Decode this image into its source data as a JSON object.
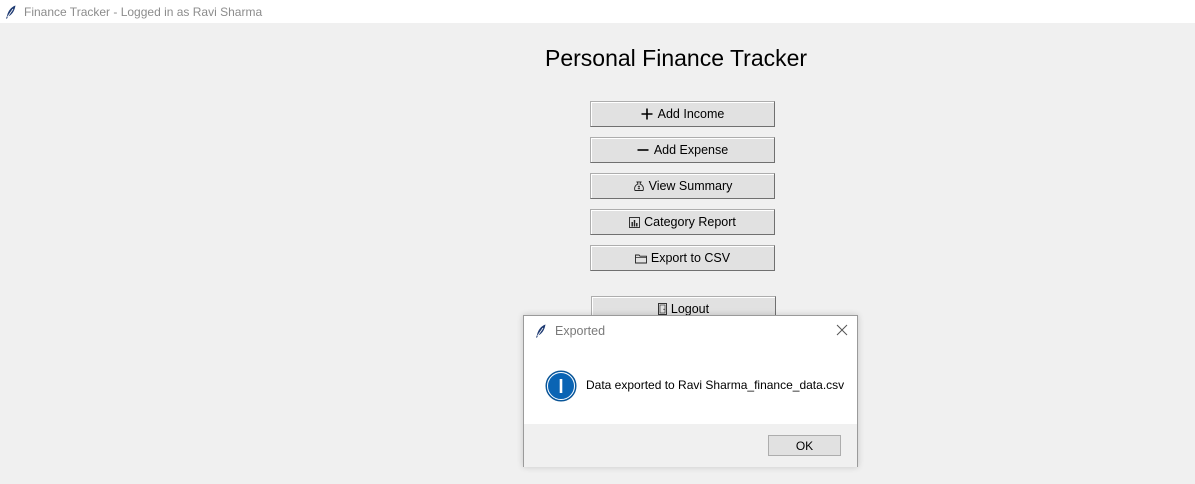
{
  "window": {
    "title": "Finance Tracker - Logged in as Ravi Sharma"
  },
  "main": {
    "heading": "Personal Finance Tracker",
    "buttons": [
      {
        "label": "Add Income",
        "icon": "plus-icon"
      },
      {
        "label": "Add Expense",
        "icon": "minus-icon"
      },
      {
        "label": "View Summary",
        "icon": "money-bag-icon"
      },
      {
        "label": "Category Report",
        "icon": "bar-chart-icon"
      },
      {
        "label": "Export to CSV",
        "icon": "folder-icon"
      }
    ],
    "logout": {
      "label": "Logout",
      "icon": "door-icon"
    }
  },
  "dialog": {
    "title": "Exported",
    "message": "Data exported to Ravi Sharma_finance_data.csv",
    "ok_label": "OK",
    "icon": "info-icon"
  },
  "colors": {
    "background": "#f0f0f0",
    "button_face": "#e1e1e1",
    "info_blue": "#0a64b4"
  }
}
